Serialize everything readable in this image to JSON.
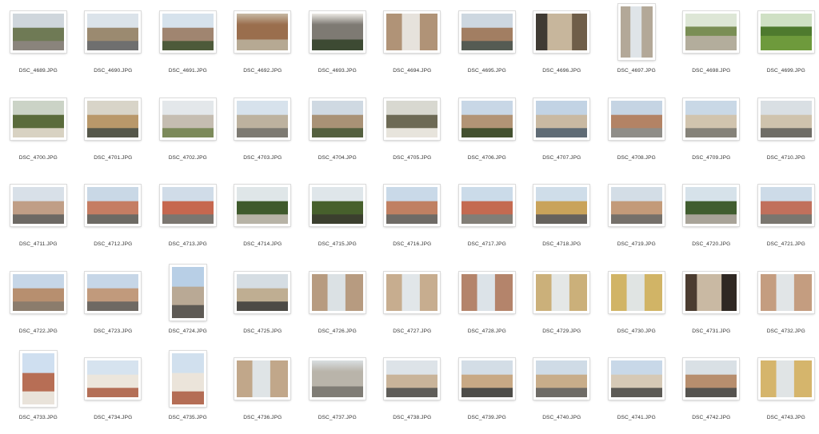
{
  "window": {
    "background": "#ffffff"
  },
  "files": [
    {
      "name": "DSC_4689.JPG",
      "orientation": "landscape",
      "scene": "street-trees",
      "palette": [
        "#cfd6dc",
        "#6f7a55",
        "#8a847c"
      ]
    },
    {
      "name": "DSC_4690.JPG",
      "orientation": "landscape",
      "scene": "street-cars",
      "palette": [
        "#dbe3ea",
        "#9b8a70",
        "#6f6f6f"
      ]
    },
    {
      "name": "DSC_4691.JPG",
      "orientation": "landscape",
      "scene": "building-trees",
      "palette": [
        "#d6e2ec",
        "#a08570",
        "#4d5a3a"
      ]
    },
    {
      "name": "DSC_4692.JPG",
      "orientation": "landscape",
      "scene": "facade-door",
      "palette": [
        "#c7b9a4",
        "#9a6e4d",
        "#b6a993"
      ]
    },
    {
      "name": "DSC_4693.JPG",
      "orientation": "landscape",
      "scene": "facade-windows",
      "palette": [
        "#ece9e4",
        "#7e7a73",
        "#3d4a33"
      ]
    },
    {
      "name": "DSC_4694.JPG",
      "orientation": "landscape",
      "scene": "alley",
      "palette": [
        "#e6e2dc",
        "#b09377",
        "#8c857c"
      ]
    },
    {
      "name": "DSC_4695.JPG",
      "orientation": "landscape",
      "scene": "street-people",
      "palette": [
        "#cdd7e0",
        "#a27e62",
        "#555b53"
      ]
    },
    {
      "name": "DSC_4696.JPG",
      "orientation": "landscape",
      "scene": "shopfront",
      "palette": [
        "#3f3a33",
        "#c7b69c",
        "#6f5e49"
      ]
    },
    {
      "name": "DSC_4697.JPG",
      "orientation": "portrait",
      "scene": "narrow-street",
      "palette": [
        "#dfe4e8",
        "#b3a898",
        "#6b6d63"
      ]
    },
    {
      "name": "DSC_4698.JPG",
      "orientation": "landscape",
      "scene": "park",
      "palette": [
        "#dde6d6",
        "#7a8e55",
        "#b3ad9c"
      ]
    },
    {
      "name": "DSC_4699.JPG",
      "orientation": "landscape",
      "scene": "park-green",
      "palette": [
        "#cfe0c4",
        "#4e7a2e",
        "#6e9a3c"
      ]
    },
    {
      "name": "DSC_4700.JPG",
      "orientation": "landscape",
      "scene": "cafe-trees",
      "palette": [
        "#cbd3c6",
        "#5a6b3b",
        "#d8d2c2"
      ]
    },
    {
      "name": "DSC_4701.JPG",
      "orientation": "landscape",
      "scene": "umbrellas",
      "palette": [
        "#d8d4c8",
        "#b9986a",
        "#55574a"
      ]
    },
    {
      "name": "DSC_4702.JPG",
      "orientation": "landscape",
      "scene": "building-square",
      "palette": [
        "#e3e7ea",
        "#c5bdb1",
        "#7c8a5a"
      ]
    },
    {
      "name": "DSC_4703.JPG",
      "orientation": "landscape",
      "scene": "building-square",
      "palette": [
        "#d7e2ec",
        "#bdb29f",
        "#7d7a72"
      ]
    },
    {
      "name": "DSC_4704.JPG",
      "orientation": "landscape",
      "scene": "street-trees",
      "palette": [
        "#cfd9e2",
        "#a99276",
        "#54603f"
      ]
    },
    {
      "name": "DSC_4705.JPG",
      "orientation": "landscape",
      "scene": "market",
      "palette": [
        "#d8d8d0",
        "#6d6a55",
        "#e7e4dc"
      ]
    },
    {
      "name": "DSC_4706.JPG",
      "orientation": "landscape",
      "scene": "building-trees",
      "palette": [
        "#c8d7e6",
        "#b29476",
        "#43502f"
      ]
    },
    {
      "name": "DSC_4707.JPG",
      "orientation": "landscape",
      "scene": "tower-street",
      "palette": [
        "#c2d3e4",
        "#c9b9a2",
        "#5f6b75"
      ]
    },
    {
      "name": "DSC_4708.JPG",
      "orientation": "landscape",
      "scene": "street-buildings",
      "palette": [
        "#c5d4e3",
        "#b38365",
        "#8f8d88"
      ]
    },
    {
      "name": "DSC_4709.JPG",
      "orientation": "landscape",
      "scene": "colonnade",
      "palette": [
        "#c9d8e6",
        "#d1c4ae",
        "#858279"
      ]
    },
    {
      "name": "DSC_4710.JPG",
      "orientation": "landscape",
      "scene": "colonnade",
      "palette": [
        "#d9dfe3",
        "#cfc3ad",
        "#6f6d66"
      ]
    },
    {
      "name": "DSC_4711.JPG",
      "orientation": "landscape",
      "scene": "piazza-facades",
      "palette": [
        "#d8e0e8",
        "#c09e86",
        "#6d6964"
      ]
    },
    {
      "name": "DSC_4712.JPG",
      "orientation": "landscape",
      "scene": "piazza-facades",
      "palette": [
        "#c9d8e6",
        "#c57d63",
        "#6d6a64"
      ]
    },
    {
      "name": "DSC_4713.JPG",
      "orientation": "landscape",
      "scene": "piazza-facades",
      "palette": [
        "#d0dce8",
        "#c6674f",
        "#7b7670"
      ]
    },
    {
      "name": "DSC_4714.JPG",
      "orientation": "landscape",
      "scene": "monument-trees",
      "palette": [
        "#dfe6e8",
        "#3f5a2c",
        "#b7b3a6"
      ]
    },
    {
      "name": "DSC_4715.JPG",
      "orientation": "landscape",
      "scene": "statue-tree",
      "palette": [
        "#dfe6ea",
        "#47602c",
        "#3b3f2e"
      ]
    },
    {
      "name": "DSC_4716.JPG",
      "orientation": "landscape",
      "scene": "crowd-piazza",
      "palette": [
        "#c9d9e8",
        "#c08062",
        "#6f6b66"
      ]
    },
    {
      "name": "DSC_4717.JPG",
      "orientation": "landscape",
      "scene": "piazza-facades",
      "palette": [
        "#cbdbe9",
        "#c46a51",
        "#827e77"
      ]
    },
    {
      "name": "DSC_4718.JPG",
      "orientation": "landscape",
      "scene": "crowd-piazza",
      "palette": [
        "#cfdde9",
        "#c9a35a",
        "#66625d"
      ]
    },
    {
      "name": "DSC_4719.JPG",
      "orientation": "landscape",
      "scene": "crowd-piazza",
      "palette": [
        "#d3dde6",
        "#c39a79",
        "#75706a"
      ]
    },
    {
      "name": "DSC_4720.JPG",
      "orientation": "landscape",
      "scene": "monument-trees",
      "palette": [
        "#d6e2ea",
        "#405d2f",
        "#a8a398"
      ]
    },
    {
      "name": "DSC_4721.JPG",
      "orientation": "landscape",
      "scene": "piazza-facades",
      "palette": [
        "#cddbe8",
        "#c1705c",
        "#7a766f"
      ]
    },
    {
      "name": "DSC_4722.JPG",
      "orientation": "landscape",
      "scene": "arena",
      "palette": [
        "#c6d6e7",
        "#b78f6f",
        "#8b7c6c"
      ]
    },
    {
      "name": "DSC_4723.JPG",
      "orientation": "landscape",
      "scene": "crowd-piazza",
      "palette": [
        "#c6d6e7",
        "#c19a7c",
        "#6e6963"
      ]
    },
    {
      "name": "DSC_4724.JPG",
      "orientation": "portrait",
      "scene": "tall-building",
      "palette": [
        "#b8cfe6",
        "#b9a995",
        "#5e5a55"
      ]
    },
    {
      "name": "DSC_4725.JPG",
      "orientation": "landscape",
      "scene": "cafe-street",
      "palette": [
        "#d5dde3",
        "#bfae92",
        "#4c4a45"
      ]
    },
    {
      "name": "DSC_4726.JPG",
      "orientation": "landscape",
      "scene": "shopping-street",
      "palette": [
        "#dbe1e4",
        "#b79b80",
        "#4d4c4a"
      ]
    },
    {
      "name": "DSC_4727.JPG",
      "orientation": "landscape",
      "scene": "street-perspective",
      "palette": [
        "#e1e6e9",
        "#c7ad8f",
        "#858079"
      ]
    },
    {
      "name": "DSC_4728.JPG",
      "orientation": "landscape",
      "scene": "street-perspective",
      "palette": [
        "#dce3e8",
        "#b4846b",
        "#7b7670"
      ]
    },
    {
      "name": "DSC_4729.JPG",
      "orientation": "landscape",
      "scene": "street-perspective",
      "palette": [
        "#e4e7e6",
        "#cbb07a",
        "#6c6963"
      ]
    },
    {
      "name": "DSC_4730.JPG",
      "orientation": "landscape",
      "scene": "yellow-street",
      "palette": [
        "#e0e4e3",
        "#d1b466",
        "#7d7a74"
      ]
    },
    {
      "name": "DSC_4731.JPG",
      "orientation": "landscape",
      "scene": "arcade",
      "palette": [
        "#4b3c30",
        "#c9b9a3",
        "#2f2823"
      ]
    },
    {
      "name": "DSC_4732.JPG",
      "orientation": "landscape",
      "scene": "street-perspective",
      "palette": [
        "#e1e5e7",
        "#c49d80",
        "#6d6964"
      ]
    },
    {
      "name": "DSC_4733.JPG",
      "orientation": "portrait",
      "scene": "church-facade",
      "palette": [
        "#cfdff0",
        "#b76e55",
        "#e9e3da"
      ]
    },
    {
      "name": "DSC_4734.JPG",
      "orientation": "landscape",
      "scene": "church-facade",
      "palette": [
        "#d6e3ef",
        "#ece6dc",
        "#b46f57"
      ]
    },
    {
      "name": "DSC_4735.JPG",
      "orientation": "portrait",
      "scene": "church-facade",
      "palette": [
        "#d1e0ee",
        "#ebe4da",
        "#b46d55"
      ]
    },
    {
      "name": "DSC_4736.JPG",
      "orientation": "landscape",
      "scene": "street-perspective",
      "palette": [
        "#dfe4e6",
        "#c1a78a",
        "#6f6b66"
      ]
    },
    {
      "name": "DSC_4737.JPG",
      "orientation": "landscape",
      "scene": "facade-windows",
      "palette": [
        "#d9dee1",
        "#b9b4aa",
        "#7f7c75"
      ]
    },
    {
      "name": "DSC_4738.JPG",
      "orientation": "landscape",
      "scene": "street-cars",
      "palette": [
        "#dde3e8",
        "#c9b49a",
        "#5f5d59"
      ]
    },
    {
      "name": "DSC_4739.JPG",
      "orientation": "landscape",
      "scene": "street-cars",
      "palette": [
        "#d3dde6",
        "#c8a985",
        "#4d4c49"
      ]
    },
    {
      "name": "DSC_4740.JPG",
      "orientation": "landscape",
      "scene": "building-square",
      "palette": [
        "#cfdbe6",
        "#c8ad8a",
        "#6e6b66"
      ]
    },
    {
      "name": "DSC_4741.JPG",
      "orientation": "landscape",
      "scene": "building-square",
      "palette": [
        "#c8d8e8",
        "#d6c9b6",
        "#5c5a55"
      ]
    },
    {
      "name": "DSC_4742.JPG",
      "orientation": "landscape",
      "scene": "street-cars",
      "palette": [
        "#d9e0e5",
        "#b78e6e",
        "#55534f"
      ]
    },
    {
      "name": "DSC_4743.JPG",
      "orientation": "landscape",
      "scene": "street-perspective",
      "palette": [
        "#e0e4e5",
        "#d5b56c",
        "#5b5955"
      ]
    }
  ]
}
